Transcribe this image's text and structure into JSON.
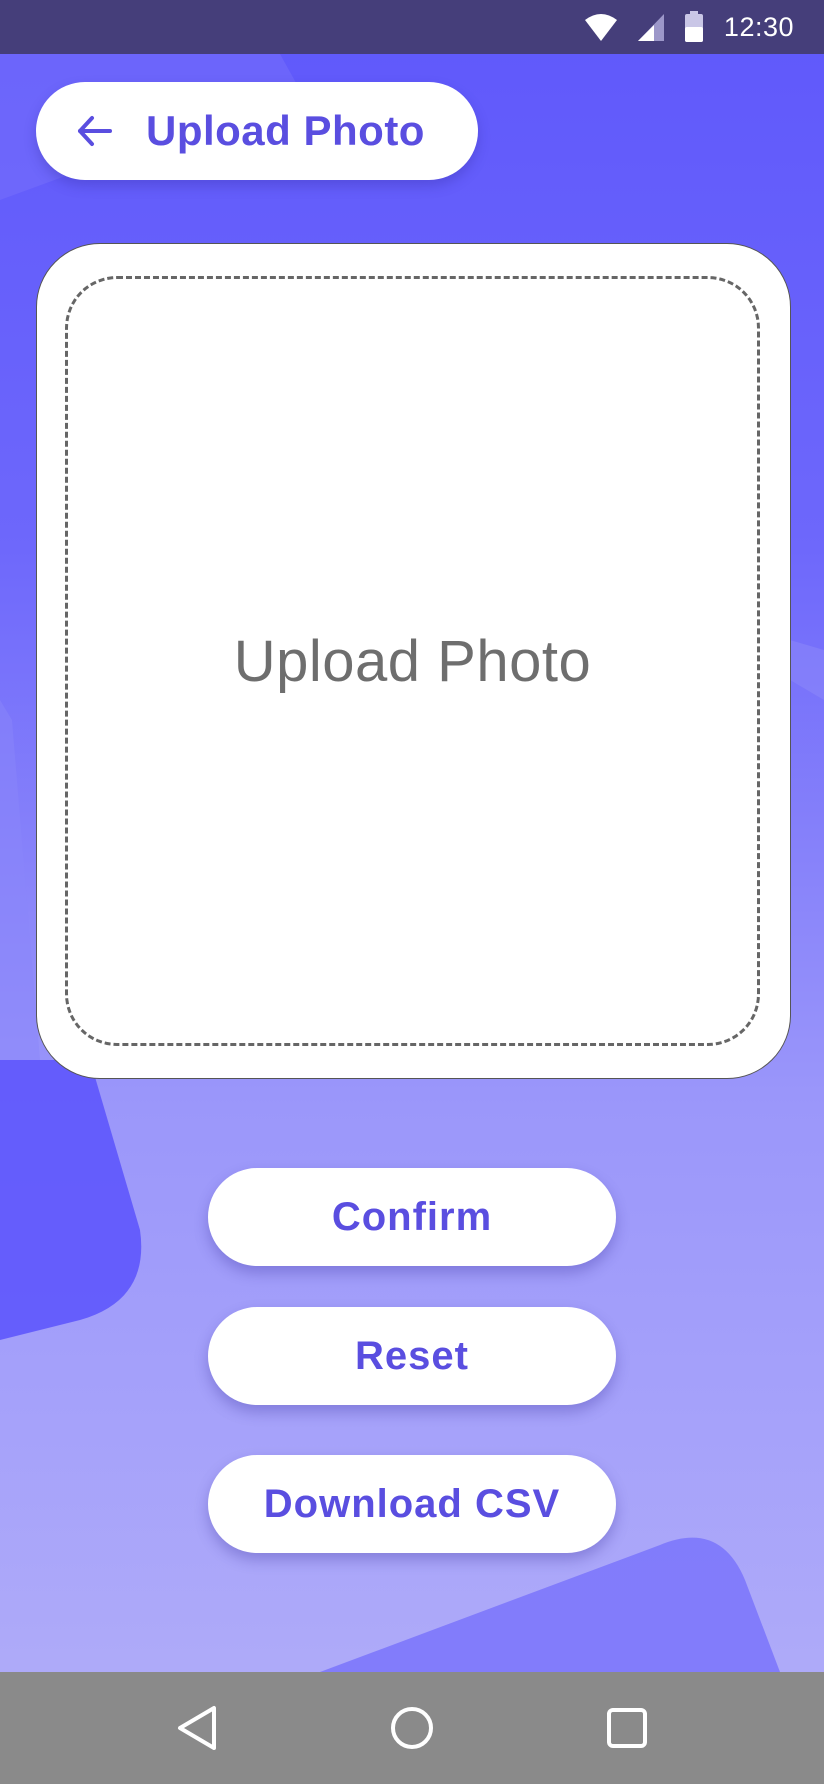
{
  "status_bar": {
    "time": "12:30",
    "icons": [
      "wifi-icon",
      "cellular-signal-icon",
      "battery-icon"
    ]
  },
  "header": {
    "back_icon": "arrow-left-icon",
    "title": "Upload Photo"
  },
  "upload_card": {
    "label": "Upload Photo"
  },
  "actions": {
    "confirm_label": "Confirm",
    "reset_label": "Reset",
    "download_label": "Download CSV"
  },
  "nav": {
    "icons": [
      "back-triangle-icon",
      "home-circle-icon",
      "recents-square-icon"
    ]
  },
  "colors": {
    "accent": "#5a4ee0",
    "status_bar": "#453e7a",
    "nav_bar": "#8a8a8a",
    "background_top": "#5f58fb",
    "background_bottom": "#b2aef9"
  }
}
